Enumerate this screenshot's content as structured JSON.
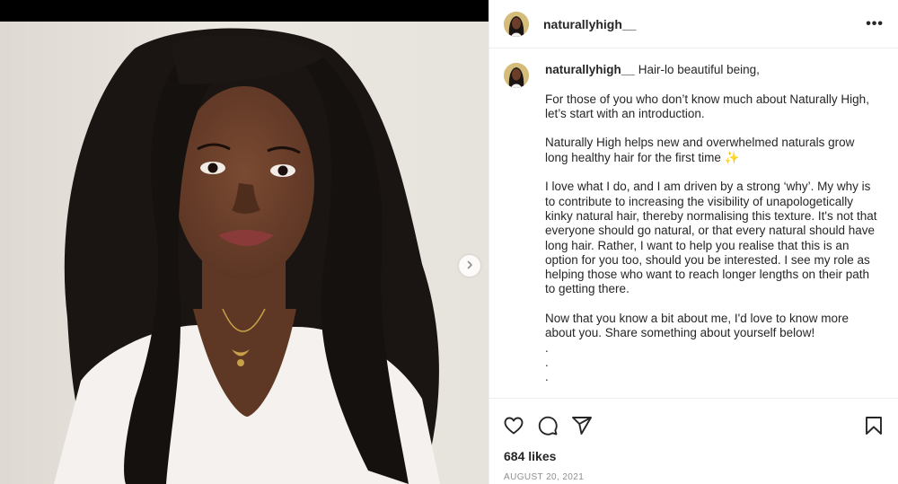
{
  "post": {
    "username": "naturallyhigh__",
    "caption": {
      "opening": "Hair-lo beautiful being,",
      "paragraphs": [
        "For those of you who don’t know much about Naturally High, let’s start with an introduction.",
        "Naturally High helps new and overwhelmed naturals grow long healthy hair for the first time",
        "I love what I do, and I am driven by a strong ‘why’. My why is to contribute to increasing the visibility of unapologetically kinky natural hair, thereby normalising this texture. It's not that everyone should go natural, or that every natural should have long hair. Rather, I want to help you realise that this is an option for you too, should you be interested. I see my role as helping those who want to reach longer lengths on their path to getting there.",
        "Now that you know a bit about me, I'd love to know more about you. Share something about yourself below!"
      ],
      "sparkle": "✨",
      "dots": [
        ".",
        ".",
        "."
      ]
    },
    "likes": "684 likes",
    "date": "AUGUST 20, 2021"
  },
  "icons": {
    "more": "more-options-icon",
    "like": "heart-icon",
    "comment": "comment-icon",
    "share": "share-icon",
    "save": "bookmark-icon",
    "next": "chevron-right-icon"
  },
  "colors": {
    "text": "#262626",
    "muted": "#8e8e8e",
    "divider": "#efefef"
  }
}
